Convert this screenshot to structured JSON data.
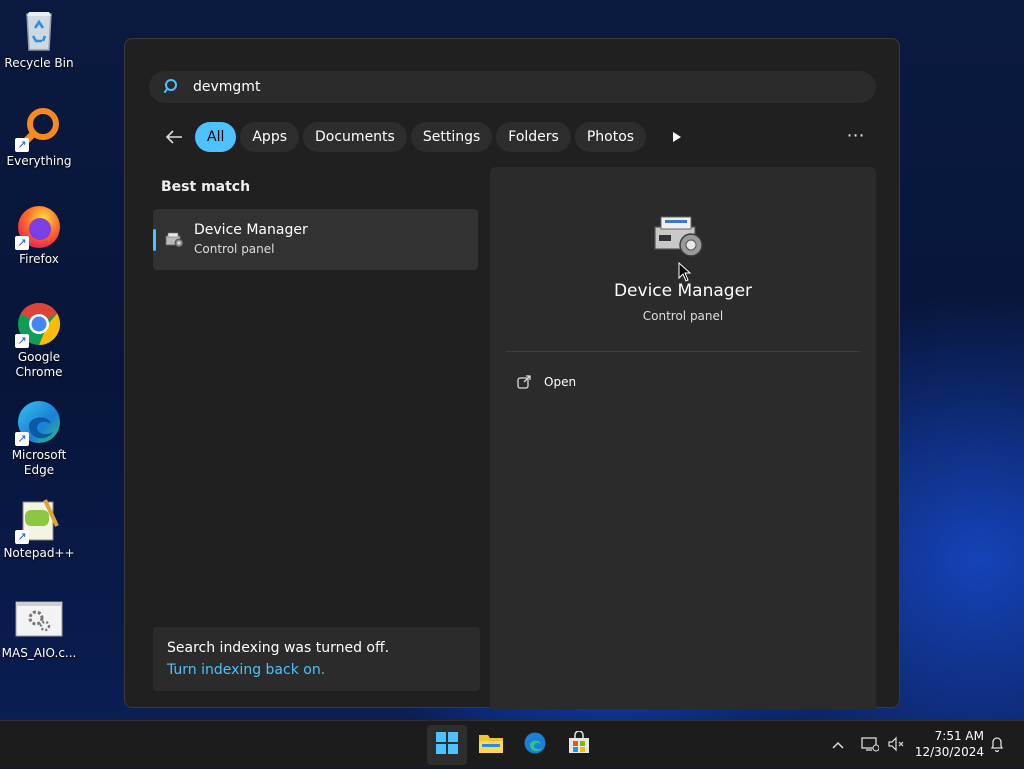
{
  "desktop": {
    "icons": [
      {
        "label": "Recycle Bin",
        "icon": "recycle-bin-icon"
      },
      {
        "label": "Everything",
        "icon": "everything-search-icon"
      },
      {
        "label": "Firefox",
        "icon": "firefox-icon"
      },
      {
        "label": "Google Chrome",
        "icon": "chrome-icon"
      },
      {
        "label": "Microsoft Edge",
        "icon": "edge-icon"
      },
      {
        "label": "Notepad++",
        "icon": "notepadpp-icon"
      },
      {
        "label": "MAS_AIO.c...",
        "icon": "cmd-script-icon"
      }
    ]
  },
  "search": {
    "query": "devmgmt"
  },
  "filters": {
    "items": [
      "All",
      "Apps",
      "Documents",
      "Settings",
      "Folders",
      "Photos"
    ],
    "active": "All"
  },
  "results": {
    "section_title": "Best match",
    "best": {
      "name": "Device Manager",
      "subtitle": "Control panel"
    }
  },
  "details": {
    "name": "Device Manager",
    "subtitle": "Control panel",
    "actions": [
      "Open"
    ]
  },
  "notice": {
    "message": "Search indexing was turned off.",
    "link": "Turn indexing back on."
  },
  "taskbar": {
    "apps": [
      "start-icon",
      "file-explorer-icon",
      "edge-icon",
      "microsoft-store-icon"
    ],
    "time": "7:51 AM",
    "date": "12/30/2024"
  },
  "colors": {
    "accent": "#4cc2ff",
    "panel_bg": "#202020",
    "details_bg": "#2b2b2b"
  }
}
